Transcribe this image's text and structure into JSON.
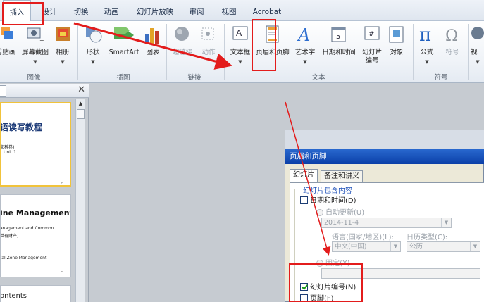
{
  "tabs": [
    {
      "label": "插入",
      "active": true
    },
    {
      "label": "设计"
    },
    {
      "label": "切换"
    },
    {
      "label": "动画"
    },
    {
      "label": "幻灯片放映"
    },
    {
      "label": "审阅"
    },
    {
      "label": "视图"
    },
    {
      "label": "Acrobat"
    }
  ],
  "ribbon": {
    "buttons": {
      "clipart": "剪贴画",
      "screenshot": "屏幕截图",
      "album": "相册",
      "shapes": "形状",
      "smartart": "SmartArt",
      "chart": "图表",
      "hyperlink": "超链接",
      "action": "动作",
      "textbox": "文本框",
      "header_footer": "页眉和页脚",
      "wordart": "艺术字",
      "datetime": "日期和时间",
      "slide_number_1": "幻灯片",
      "slide_number_2": "编号",
      "object": "对象",
      "equation": "公式",
      "symbol": "符号",
      "video": "视"
    },
    "groups": {
      "images": "图像",
      "illustrations": "插图",
      "links": "链接",
      "text": "文本",
      "symbols": "符号"
    }
  },
  "slides": [
    {
      "title": "语读写教程",
      "line1": "文科卷)",
      "line2": "Unit 1"
    },
    {
      "title": "ine Management",
      "line1": "anagement and Common",
      "line2": "共有财产)",
      "line3": "tal Zone Management"
    },
    {
      "title": "ontents"
    }
  ],
  "dialog": {
    "title": "页眉和页脚",
    "tabs": [
      "幻灯片",
      "备注和讲义"
    ],
    "group_label": "幻灯片包含内容",
    "date_time": "日期和时间(D)",
    "auto_update": "自动更新(U)",
    "date_value": "2014-11-4",
    "language_label": "语言(国家/地区)(L):",
    "calendar_label": "日历类型(C):",
    "language_value": "中文(中国)",
    "calendar_value": "公历",
    "fixed": "固定(X)",
    "slide_number": "幻灯片编号(N)",
    "slide_number_checked": true,
    "footer": "页脚(F)",
    "footer_checked": false
  },
  "annotation_color": "#e31c1c"
}
